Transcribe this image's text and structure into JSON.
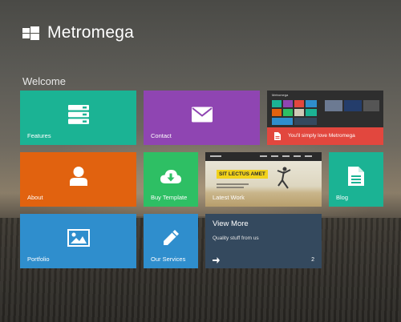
{
  "app": {
    "title": "Metromega"
  },
  "section": {
    "heading": "Welcome"
  },
  "tiles": {
    "features": {
      "label": "Features",
      "icon": "server-icon"
    },
    "contact": {
      "label": "Contact",
      "icon": "envelope-icon"
    },
    "promo": {
      "text": "You'll simply love Metromega",
      "icon": "document-icon",
      "mini_title": "Metromega"
    },
    "about": {
      "label": "About",
      "icon": "user-icon"
    },
    "buy": {
      "label": "Buy Template",
      "icon": "cloud-download-icon"
    },
    "latest": {
      "label": "Latest Work",
      "banner": "SIT LECTUS AMET"
    },
    "blog": {
      "label": "Blog",
      "icon": "document-icon"
    },
    "portfolio": {
      "label": "Portfolio",
      "icon": "image-icon"
    },
    "services": {
      "label": "Our Services",
      "icon": "pencil-icon"
    },
    "viewmore": {
      "title": "View More",
      "subtitle": "Quality stuff from us",
      "count": "2",
      "icon": "arrow-right-icon"
    }
  },
  "colors": {
    "green": "#1bb394",
    "purple": "#8f45b2",
    "orange": "#e1620f",
    "light_green": "#2ebf64",
    "blue": "#2f8ecd",
    "navy": "#34495e",
    "red": "#e2473e"
  }
}
